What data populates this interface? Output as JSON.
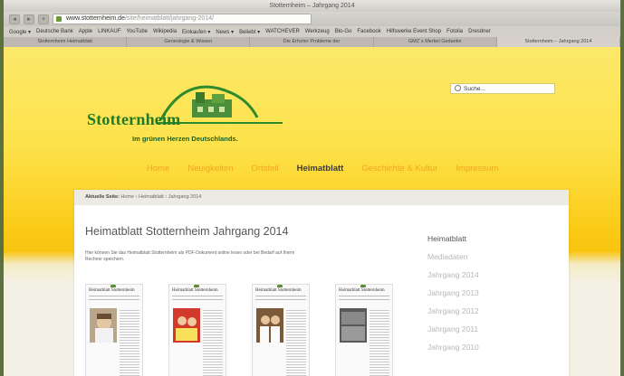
{
  "browser": {
    "window_title": "Stotternheim – Jahrgang 2014",
    "url_host": "www.stotternheim.de",
    "url_path": "/site/heimatblatt/jahrgang-2014/",
    "bookmarks": [
      "Google ▾",
      "Deutsche Bank",
      "Apple",
      "LINKAUF",
      "YouTube",
      "Wikipedia",
      "Einkaufen ▾",
      "News ▾",
      "Beliebt ▾",
      "WATCHEVER",
      "Werkzeug",
      "Blo-Go",
      "Facebook",
      "Hilfswerke Event Shop",
      "Fotolia",
      "Dresdner"
    ],
    "tabs": [
      "Stotternheim Heimatblatt",
      "Geneologie & Wissen",
      "Die Erfurter Probleme der",
      "GMZ´s Merkel Gedanke",
      "Stotternheim – Jahrgang 2014"
    ]
  },
  "header": {
    "search_placeholder": "Suche...",
    "logo_name": "Stotternheim",
    "logo_slogan": "Im grünen Herzen Deutschlands."
  },
  "main_nav": [
    "Home",
    "Neuigkeiten",
    "Ortsteil",
    "Heimatblatt",
    "Geschichte & Kultur",
    "Impressum"
  ],
  "breadcrumb": {
    "label": "Aktuelle Seite:",
    "items": [
      "Home",
      "Heimatblatt",
      "Jahrgang 2014"
    ]
  },
  "page": {
    "title": "Heimatblatt Stotternheim Jahrgang 2014",
    "intro": "Hier können Sie das Heimatblatt Stotternheim als PDF-Dokument online lesen oder bei Bedarf auf Ihrem Rechner speichern."
  },
  "thumbnails": [
    {
      "masthead": "Heimatblatt Stotternheim"
    },
    {
      "masthead": "Heimatblatt Stotternheim"
    },
    {
      "masthead": "Heimatblatt Stotternheim"
    },
    {
      "masthead": "Heimatblatt Stotternheim"
    }
  ],
  "sidebar": [
    "Heimatblatt",
    "Mediadaten",
    "Jahrgang 2014",
    "Jahrgang 2013",
    "Jahrgang 2012",
    "Jahrgang 2011",
    "Jahrgang 2010"
  ],
  "colors": {
    "brand_green": "#1f7a2a",
    "nav_orange": "#f3a51e",
    "yellow": "#fbcb18"
  }
}
